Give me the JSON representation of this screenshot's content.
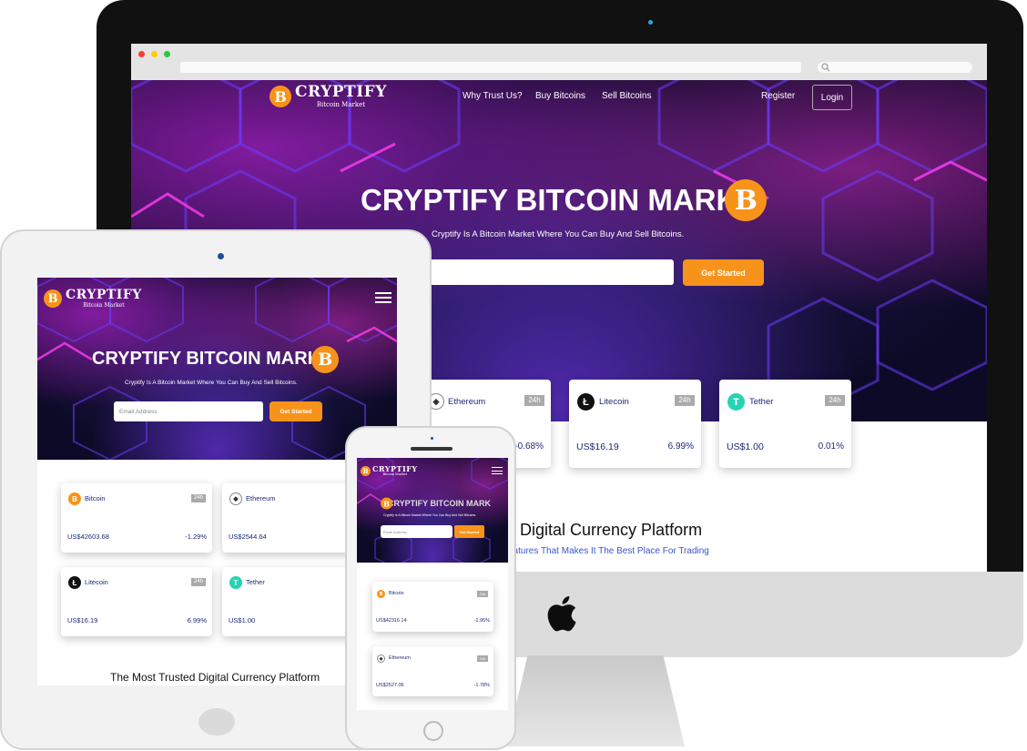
{
  "brand": {
    "name": "CRYPTIFY",
    "subtitle": "Bitcoin Market",
    "coin_glyph": "B"
  },
  "nav": {
    "links": [
      "Why Trust Us?",
      "Buy Bitcoins",
      "Sell Bitcoins"
    ],
    "register": "Register",
    "login": "Login"
  },
  "hero": {
    "title": "CRYPTIFY BITCOIN MARK",
    "subtitle": "Cryptify Is A Bitcoin Market Where You Can Buy And Sell Bitcoins.",
    "email_placeholder": "Email Address",
    "cta": "Get Started"
  },
  "icons": {
    "bitcoin": "B",
    "ethereum": "◆",
    "litecoin": "Ł",
    "tether": "T"
  },
  "imac": {
    "cards": [
      {
        "name": "Ethereum",
        "tag": "24h",
        "price": "",
        "change": "-0.68%"
      },
      {
        "name": "Litecoin",
        "tag": "24h",
        "price": "US$16.19",
        "change": "6.99%"
      },
      {
        "name": "Tether",
        "tag": "24h",
        "price": "US$1.00",
        "change": "0.01%"
      }
    ],
    "section_title": "d Digital Currency Platform",
    "section_subtitle": "eatures That Makes It The Best Place For Trading"
  },
  "ipad": {
    "cards": [
      {
        "name": "Bitcoin",
        "tag": "24h",
        "price": "US$42603.68",
        "change": "-1.29%"
      },
      {
        "name": "Ethereum",
        "tag": "24h",
        "price": "US$2544.64",
        "change": "-"
      },
      {
        "name": "Litecoin",
        "tag": "24h",
        "price": "US$16.19",
        "change": "6.99%"
      },
      {
        "name": "Tether",
        "tag": "24h",
        "price": "US$1.00",
        "change": ""
      }
    ],
    "section_title": "The Most Trusted Digital Currency Platform"
  },
  "iphone": {
    "cards": [
      {
        "name": "Bitcoin",
        "tag": "24h",
        "price": "US$42316.14",
        "change": "-1.95%"
      },
      {
        "name": "Ethereum",
        "tag": "24h",
        "price": "US$2527.06",
        "change": "-1.78%"
      }
    ]
  },
  "colors": {
    "accent": "#f7931a",
    "text_dark": "#1b2a78",
    "link_blue": "#3a56c8",
    "tether": "#26d3b3"
  }
}
